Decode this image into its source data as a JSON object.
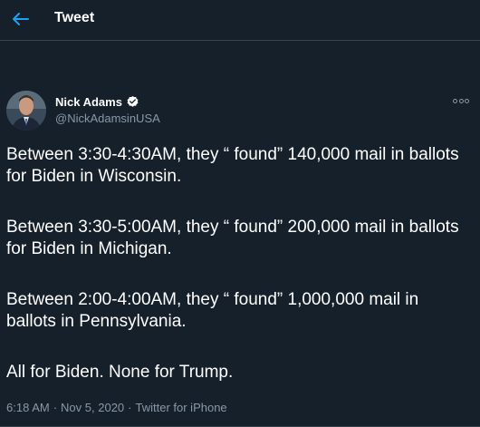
{
  "header": {
    "title": "Tweet",
    "back_icon": "arrow-left-icon",
    "accent": "#1da1f2"
  },
  "tweet": {
    "author": {
      "name": "Nick Adams",
      "handle": "@NickAdamsinUSA",
      "verified": true
    },
    "paragraphs": [
      "Between 3:30-4:30AM, they “ found” 140,000 mail in ballots for Biden in Wisconsin.",
      "Between 3:30-5:00AM, they “ found” 200,000 mail in ballots for Biden in Michigan.",
      "Between 2:00-4:00AM, they “ found” 1,000,000 mail in ballots in Pennsylvania.",
      "All for Biden. None for Trump."
    ],
    "meta": {
      "time": "6:18 AM",
      "separator1": "·",
      "date": "Nov 5, 2020",
      "separator2": "·",
      "source": "Twitter for iPhone"
    }
  },
  "colors": {
    "background": "#15202b",
    "border": "#38444d",
    "secondary_text": "#8899a6"
  }
}
